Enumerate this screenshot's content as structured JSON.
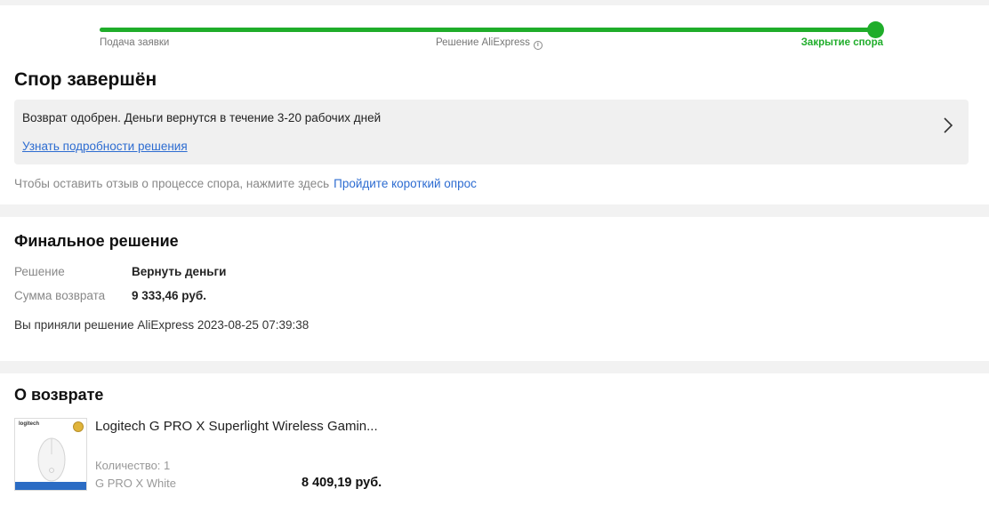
{
  "progress": {
    "fraction": 1.0,
    "steps": [
      "Подача заявки",
      "Решение AliExpress",
      "Закрытие спора"
    ],
    "active_color": "#1fad2a"
  },
  "status": {
    "title": "Спор завершён",
    "notice_text": "Возврат одобрен. Деньги вернутся в течение 3-20 рабочих дней",
    "notice_link": "Узнать подробности решения",
    "survey_text": "Чтобы оставить отзыв о процессе спора, нажмите здесь",
    "survey_link": "Пройдите короткий опрос"
  },
  "decision": {
    "title": "Финальное решение",
    "rows": [
      {
        "label": "Решение",
        "value": "Вернуть деньги"
      },
      {
        "label": "Сумма возврата",
        "value": "9 333,46 руб."
      }
    ],
    "accepted_text": "Вы приняли решение AliExpress 2023-08-25 07:39:38"
  },
  "return_info": {
    "title": "О возврате",
    "product_name": "Logitech G PRO X Superlight Wireless Gamin...",
    "quantity": "Количество: 1",
    "variant": "G PRO X White",
    "price": "8 409,19 руб.",
    "thumb_logo": "logitech"
  },
  "colors": {
    "link": "#2d6cd1",
    "accent": "#1fad2a"
  }
}
